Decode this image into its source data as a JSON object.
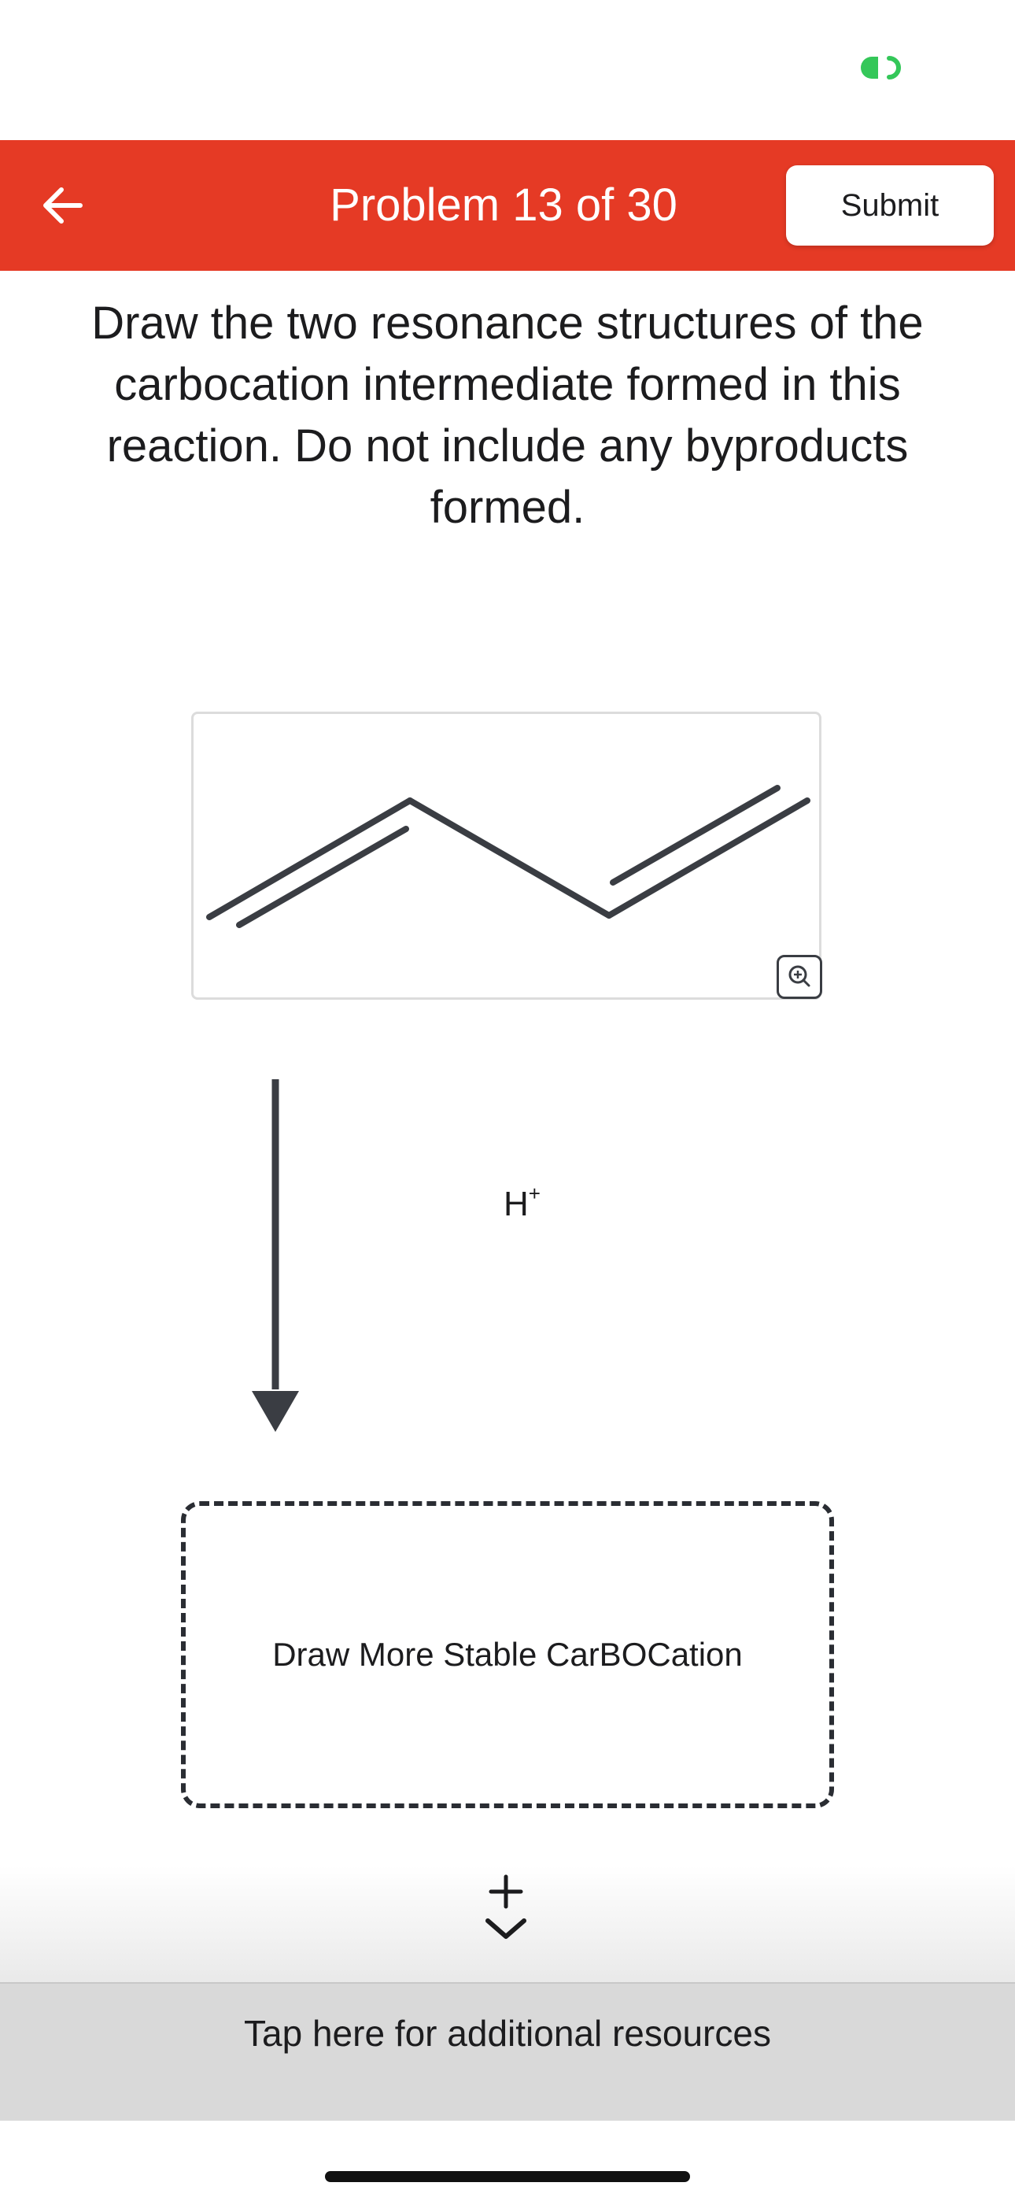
{
  "header": {
    "title": "Problem 13 of 30",
    "submit_label": "Submit",
    "background_color": "#e53a25"
  },
  "prompt": {
    "text": "Draw the two resonance structures of the carbocation intermediate formed in this reaction. Do not include any byproducts formed."
  },
  "reaction": {
    "reagent": "H",
    "reagent_charge": "+"
  },
  "answer_box": {
    "label": "Draw More Stable CarBOCation"
  },
  "footer": {
    "resources_label": "Tap here for additional resources"
  },
  "icons": {
    "back": "arrow-left-icon",
    "zoom": "zoom-in-icon",
    "expand": "plus-icon",
    "collapse": "chevron-down-icon",
    "status": "link-icon"
  }
}
